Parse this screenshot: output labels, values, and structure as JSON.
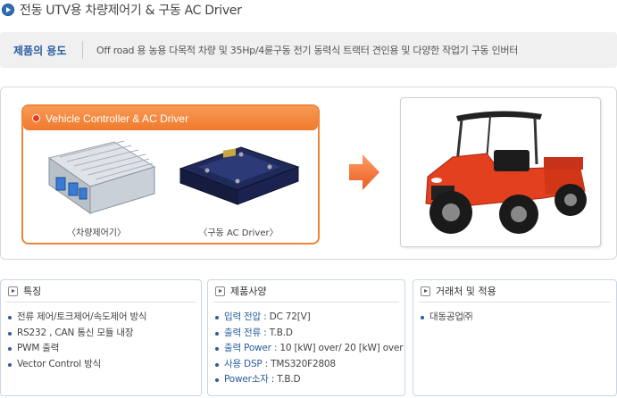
{
  "header": {
    "title": "전동 UTV용 차량제어기 & 구동 AC Driver"
  },
  "usage": {
    "label": "제품의 용도",
    "text": "Off road 용 농용 다목적 차량 및 35Hp/4륜구동 전기 동력식 트랙터 견인용 및 다양한 작업기 구동 인버터"
  },
  "showcase": {
    "box_title": "Vehicle Controller & AC Driver",
    "products": [
      {
        "caption": "〈차량제어기〉",
        "icon": "vehicle-controller-image"
      },
      {
        "caption": "〈구동 AC Driver〉",
        "icon": "ac-driver-image"
      }
    ],
    "arrow_icon": "right-arrow-icon",
    "vehicle_icon": "utv-vehicle-image",
    "colors": {
      "accent": "#f0843a",
      "arrow": "#f26a2e",
      "vehicle": "#e2401f"
    }
  },
  "features": {
    "title": "특징",
    "items": [
      "전류 제어/토크제어/속도제어 방식",
      "RS232 , CAN 통신 모듈 내장",
      "PWM 출력",
      "Vector Control 방식"
    ]
  },
  "specs": {
    "title": "제품사양",
    "items": [
      {
        "key": "입력 전압 :",
        "value": " DC 72[V]"
      },
      {
        "key": "출력 전류 :",
        "value": " T.B.D"
      },
      {
        "key": "출력 Power :",
        "value": " 10 [kW] over/ 20 [kW] over"
      },
      {
        "key": "사용 DSP :",
        "value": " TMS320F2808"
      },
      {
        "key": "Power소자",
        "value": " : T.B.D"
      }
    ]
  },
  "clients": {
    "title": "거래처 및 적용",
    "items": [
      "대동공업㈜"
    ]
  }
}
